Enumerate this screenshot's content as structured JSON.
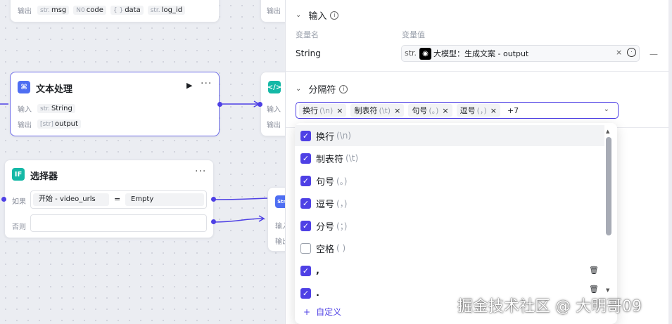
{
  "canvas": {
    "top_node": {
      "output_label": "输出",
      "outputs": [
        {
          "type": "str.",
          "name": "msg"
        },
        {
          "type": "N0",
          "name": "code"
        },
        {
          "type": "{ }",
          "name": "data"
        },
        {
          "type": "str.",
          "name": "log_id"
        }
      ]
    },
    "top_node_right": {
      "output_label": "输出"
    },
    "text_node": {
      "title": "文本处理",
      "input_label": "输入",
      "output_label": "输出",
      "input": {
        "type": "str.",
        "name": "String"
      },
      "output": {
        "type": "[str]",
        "name": "output"
      }
    },
    "code_node": {
      "input_label": "输入",
      "output_label": "输出"
    },
    "selector_node": {
      "title": "选择器",
      "if_label": "如果",
      "else_label": "否则",
      "condition_left": "开始 - video_urls",
      "condition_op": "=",
      "condition_right": "Empty"
    },
    "right_node": {
      "input_label": "输入",
      "output_label": "输出"
    }
  },
  "panel": {
    "input_section": {
      "title": "输入",
      "col_name": "变量名",
      "col_value": "变量值",
      "var_name": "String",
      "var_type": "str.",
      "var_value": "大模型：生成文案 - output"
    },
    "separator_section": {
      "title": "分隔符",
      "chips": [
        {
          "label": "换行",
          "sub": "(\\n)"
        },
        {
          "label": "制表符",
          "sub": "(\\t)"
        },
        {
          "label": "句号",
          "sub": "(。)"
        },
        {
          "label": "逗号",
          "sub": "(，)"
        }
      ],
      "more": "+7"
    },
    "dropdown": {
      "options": [
        {
          "label": "换行",
          "sub": "(\\n)",
          "checked": true
        },
        {
          "label": "制表符",
          "sub": "(\\t)",
          "checked": true
        },
        {
          "label": "句号",
          "sub": "(。)",
          "checked": true
        },
        {
          "label": "逗号",
          "sub": "(，)",
          "checked": true
        },
        {
          "label": "分号",
          "sub": "(；)",
          "checked": true
        },
        {
          "label": "空格",
          "sub": "( )",
          "checked": false
        },
        {
          "label": ",",
          "sub": "",
          "checked": true
        },
        {
          "label": ".",
          "sub": "",
          "checked": true
        }
      ],
      "add_label": "自定义"
    }
  },
  "watermark": "掘金技术社区 @ 大明哥09",
  "colors": {
    "accent": "#4e40e5",
    "selected_border": "#6d6ce8"
  }
}
